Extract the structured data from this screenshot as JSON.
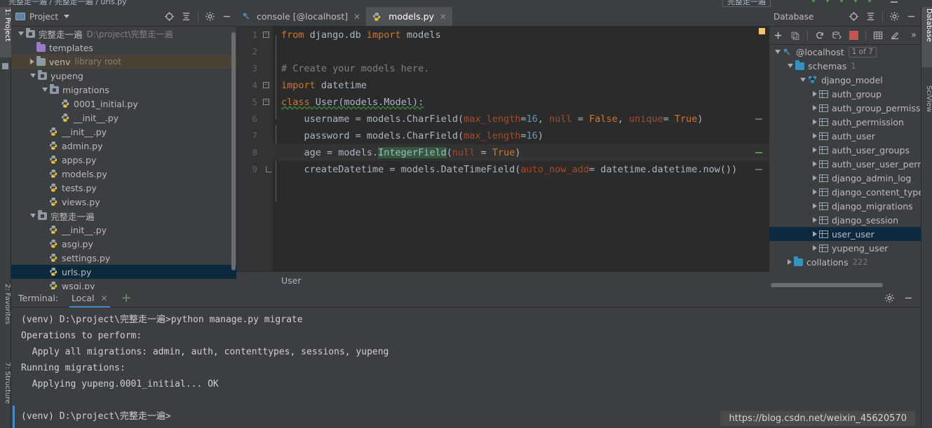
{
  "top_strip": {
    "breadcrumb": "完整走一遍  /  完整走一遍  /  urls.py",
    "right_box": "完整走一遍"
  },
  "left_rail": {
    "tabs": [
      {
        "label": "1: Project",
        "active": true
      },
      {
        "label": "2: Favorites",
        "active": false
      },
      {
        "label": "7: Structure",
        "active": false
      }
    ]
  },
  "right_rail": {
    "tabs": [
      {
        "label": "Database",
        "active": true
      },
      {
        "label": "SciView",
        "active": false
      }
    ]
  },
  "project_panel": {
    "title": "Project",
    "icons": [
      "locate-icon",
      "collapse-all-icon",
      "gear-icon",
      "minimize-icon"
    ],
    "tree": [
      {
        "indent": 0,
        "arrow": "down",
        "icon": "folder-module",
        "label": "完整走一遍",
        "dim": "D:\\project\\完整走一遍",
        "state": "none"
      },
      {
        "indent": 1,
        "arrow": "none",
        "icon": "folder-templates",
        "label": "templates",
        "dim": "",
        "state": "none"
      },
      {
        "indent": 1,
        "arrow": "right",
        "icon": "folder",
        "label": "venv",
        "dim": "library root",
        "state": "hovered"
      },
      {
        "indent": 1,
        "arrow": "down",
        "icon": "folder-module",
        "label": "yupeng",
        "dim": "",
        "state": "none"
      },
      {
        "indent": 2,
        "arrow": "down",
        "icon": "folder-module",
        "label": "migrations",
        "dim": "",
        "state": "none"
      },
      {
        "indent": 3,
        "arrow": "none",
        "icon": "python",
        "label": "0001_initial.py",
        "dim": "",
        "state": "none"
      },
      {
        "indent": 3,
        "arrow": "none",
        "icon": "python",
        "label": "__init__.py",
        "dim": "",
        "state": "none"
      },
      {
        "indent": 2,
        "arrow": "none",
        "icon": "python",
        "label": "__init__.py",
        "dim": "",
        "state": "none"
      },
      {
        "indent": 2,
        "arrow": "none",
        "icon": "python",
        "label": "admin.py",
        "dim": "",
        "state": "none"
      },
      {
        "indent": 2,
        "arrow": "none",
        "icon": "python",
        "label": "apps.py",
        "dim": "",
        "state": "none"
      },
      {
        "indent": 2,
        "arrow": "none",
        "icon": "python",
        "label": "models.py",
        "dim": "",
        "state": "none"
      },
      {
        "indent": 2,
        "arrow": "none",
        "icon": "python",
        "label": "tests.py",
        "dim": "",
        "state": "none"
      },
      {
        "indent": 2,
        "arrow": "none",
        "icon": "python",
        "label": "views.py",
        "dim": "",
        "state": "none"
      },
      {
        "indent": 1,
        "arrow": "down",
        "icon": "folder-module",
        "label": "完整走一遍",
        "dim": "",
        "state": "none"
      },
      {
        "indent": 2,
        "arrow": "none",
        "icon": "python",
        "label": "__init__.py",
        "dim": "",
        "state": "none"
      },
      {
        "indent": 2,
        "arrow": "none",
        "icon": "python",
        "label": "asgi.py",
        "dim": "",
        "state": "none"
      },
      {
        "indent": 2,
        "arrow": "none",
        "icon": "python",
        "label": "settings.py",
        "dim": "",
        "state": "none"
      },
      {
        "indent": 2,
        "arrow": "none",
        "icon": "python",
        "label": "urls.py",
        "dim": "",
        "state": "selected"
      },
      {
        "indent": 2,
        "arrow": "none",
        "icon": "python",
        "label": "wsgi.py",
        "dim": "",
        "state": "none"
      }
    ]
  },
  "editor": {
    "tabs": [
      {
        "label": "console [@localhost]",
        "icon": "console-icon",
        "active": false
      },
      {
        "label": "models.py",
        "icon": "python-icon",
        "active": true
      }
    ],
    "breadcrumb": "User",
    "lines": [
      {
        "n": "1",
        "fold": "minus",
        "current": false,
        "marker": "none",
        "tokens": [
          {
            "t": "from ",
            "c": "kw"
          },
          {
            "t": "django.db ",
            "c": ""
          },
          {
            "t": "import ",
            "c": "kw"
          },
          {
            "t": "models",
            "c": ""
          }
        ]
      },
      {
        "n": "2",
        "fold": "none",
        "current": false,
        "marker": "none",
        "tokens": []
      },
      {
        "n": "3",
        "fold": "none",
        "current": false,
        "marker": "none",
        "tokens": [
          {
            "t": "# Create your models here.",
            "c": "cm"
          }
        ]
      },
      {
        "n": "4",
        "fold": "minus",
        "current": false,
        "marker": "none",
        "tokens": [
          {
            "t": "import ",
            "c": "kw"
          },
          {
            "t": "datetime",
            "c": ""
          }
        ]
      },
      {
        "n": "5",
        "fold": "minus",
        "current": false,
        "marker": "none",
        "tokens": [
          {
            "t": "class ",
            "c": "kw err"
          },
          {
            "t": "User(models.Model):",
            "c": "err"
          }
        ]
      },
      {
        "n": "6",
        "fold": "none",
        "current": false,
        "marker": "gray",
        "tokens": [
          {
            "t": "    username = models.CharField(",
            "c": ""
          },
          {
            "t": "max_length",
            "c": "param"
          },
          {
            "t": "=",
            "c": ""
          },
          {
            "t": "16",
            "c": "num"
          },
          {
            "t": ", ",
            "c": ""
          },
          {
            "t": "null",
            "c": "param"
          },
          {
            "t": " = ",
            "c": ""
          },
          {
            "t": "False",
            "c": "kw"
          },
          {
            "t": ", ",
            "c": ""
          },
          {
            "t": "unique",
            "c": "param"
          },
          {
            "t": "= ",
            "c": ""
          },
          {
            "t": "True",
            "c": "kw"
          },
          {
            "t": ")",
            "c": ""
          }
        ]
      },
      {
        "n": "7",
        "fold": "none",
        "current": false,
        "marker": "none",
        "tokens": [
          {
            "t": "    password = models.CharField(",
            "c": ""
          },
          {
            "t": "max_length",
            "c": "param"
          },
          {
            "t": "=",
            "c": ""
          },
          {
            "t": "16",
            "c": "num"
          },
          {
            "t": ")",
            "c": ""
          }
        ]
      },
      {
        "n": "8",
        "fold": "none",
        "current": true,
        "marker": "green",
        "tokens": [
          {
            "t": "    age = models.",
            "c": ""
          },
          {
            "t": "IntegerField",
            "c": "hl"
          },
          {
            "t": "(",
            "c": ""
          },
          {
            "t": "null",
            "c": "param"
          },
          {
            "t": " = ",
            "c": ""
          },
          {
            "t": "True",
            "c": "kw"
          },
          {
            "t": ")",
            "c": ""
          }
        ]
      },
      {
        "n": "9",
        "fold": "arc",
        "current": false,
        "marker": "gray",
        "tokens": [
          {
            "t": "    createDatetime = models.DateTimeField(",
            "c": ""
          },
          {
            "t": "auto_now_add",
            "c": "param"
          },
          {
            "t": "= ",
            "c": ""
          },
          {
            "t": "datetime.datetime.now())",
            "c": ""
          }
        ]
      }
    ]
  },
  "database_panel": {
    "title": "Database",
    "header_icons": [
      "locate-icon",
      "collapse-all-icon",
      "gear-icon",
      "minimize-icon"
    ],
    "toolbar_icons": [
      "add-icon",
      "copy-icon",
      "refresh-icon",
      "sql-script-icon",
      "stop-icon",
      "table-icon",
      "edit-icon",
      "more-icon"
    ],
    "tree": [
      {
        "indent": 0,
        "arrow": "down",
        "icon": "datasource",
        "label": "@localhost",
        "badge": "1 of 7",
        "count": "",
        "state": "none"
      },
      {
        "indent": 1,
        "arrow": "down",
        "icon": "folder-db",
        "label": "schemas",
        "badge": "",
        "count": "1",
        "state": "none"
      },
      {
        "indent": 2,
        "arrow": "down",
        "icon": "schema",
        "label": "django_model",
        "badge": "",
        "count": "",
        "state": "none"
      },
      {
        "indent": 3,
        "arrow": "right",
        "icon": "table",
        "label": "auth_group",
        "badge": "",
        "count": "",
        "state": "none"
      },
      {
        "indent": 3,
        "arrow": "right",
        "icon": "table",
        "label": "auth_group_permissions",
        "badge": "",
        "count": "",
        "state": "none"
      },
      {
        "indent": 3,
        "arrow": "right",
        "icon": "table",
        "label": "auth_permission",
        "badge": "",
        "count": "",
        "state": "none"
      },
      {
        "indent": 3,
        "arrow": "right",
        "icon": "table",
        "label": "auth_user",
        "badge": "",
        "count": "",
        "state": "none"
      },
      {
        "indent": 3,
        "arrow": "right",
        "icon": "table",
        "label": "auth_user_groups",
        "badge": "",
        "count": "",
        "state": "none"
      },
      {
        "indent": 3,
        "arrow": "right",
        "icon": "table",
        "label": "auth_user_user_permissions",
        "badge": "",
        "count": "",
        "state": "none"
      },
      {
        "indent": 3,
        "arrow": "right",
        "icon": "table",
        "label": "django_admin_log",
        "badge": "",
        "count": "",
        "state": "none"
      },
      {
        "indent": 3,
        "arrow": "right",
        "icon": "table",
        "label": "django_content_type",
        "badge": "",
        "count": "",
        "state": "none"
      },
      {
        "indent": 3,
        "arrow": "right",
        "icon": "table",
        "label": "django_migrations",
        "badge": "",
        "count": "",
        "state": "none"
      },
      {
        "indent": 3,
        "arrow": "right",
        "icon": "table",
        "label": "django_session",
        "badge": "",
        "count": "",
        "state": "none"
      },
      {
        "indent": 3,
        "arrow": "right",
        "icon": "table",
        "label": "user_user",
        "badge": "",
        "count": "",
        "state": "selected"
      },
      {
        "indent": 3,
        "arrow": "right",
        "icon": "table",
        "label": "yupeng_user",
        "badge": "",
        "count": "",
        "state": "none"
      },
      {
        "indent": 1,
        "arrow": "right",
        "icon": "folder-db",
        "label": "collations",
        "badge": "",
        "count": "222",
        "state": "none"
      }
    ]
  },
  "terminal": {
    "label": "Terminal:",
    "tabs": [
      {
        "label": "Local",
        "active": true
      }
    ],
    "add_label": "+",
    "tools": [
      "gear-icon",
      "minimize-icon"
    ],
    "output": [
      "(venv) D:\\project\\完整走一遍>python manage.py migrate",
      "Operations to perform:",
      "  Apply all migrations: admin, auth, contenttypes, sessions, yupeng",
      "Running migrations:",
      "  Applying yupeng.0001_initial... OK",
      "",
      "(venv) D:\\project\\完整走一遍>"
    ],
    "watermark": "https://blog.csdn.net/weixin_45620570"
  },
  "colors": {
    "panel_bg": "#3c3f41",
    "editor_bg": "#2b2b2b",
    "selection": "#0d293e",
    "hover": "#4a4234",
    "accent": "#4a88c7",
    "keyword": "#cc7832",
    "number": "#6897bb",
    "param": "#aa4926",
    "comment": "#808080",
    "search_highlight": "#32593d"
  }
}
